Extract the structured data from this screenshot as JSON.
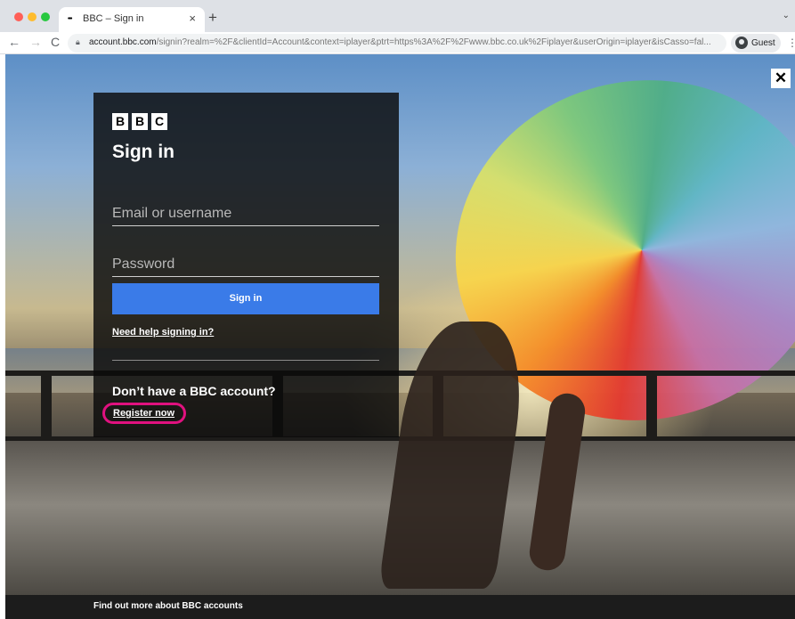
{
  "browser": {
    "tab_title": "BBC – Sign in",
    "tab_favicon": "•••",
    "tab_close": "×",
    "new_tab": "+",
    "tab_menu": "⌄",
    "back": "←",
    "forward": "→",
    "reload": "C",
    "url_host": "account.bbc.com",
    "url_path": "/signin?realm=%2F&clientId=Account&context=iplayer&ptrt=https%3A%2F%2Fwww.bbc.co.uk%2Fiplayer&userOrigin=iplayer&isCasso=fal...",
    "profile_label": "Guest",
    "menu": "⋮"
  },
  "page": {
    "close_label": "✕",
    "logo_letters": [
      "B",
      "B",
      "C"
    ],
    "title": "Sign in",
    "email_placeholder": "Email or username",
    "password_placeholder": "Password",
    "signin_button": "Sign in",
    "help_link": "Need help signing in?",
    "no_account_text": "Don’t have a BBC account?",
    "register_link": "Register now",
    "footer_link": "Find out more about BBC accounts"
  },
  "colors": {
    "signin_button": "#3a7be8",
    "register_highlight": "#e0117f"
  }
}
